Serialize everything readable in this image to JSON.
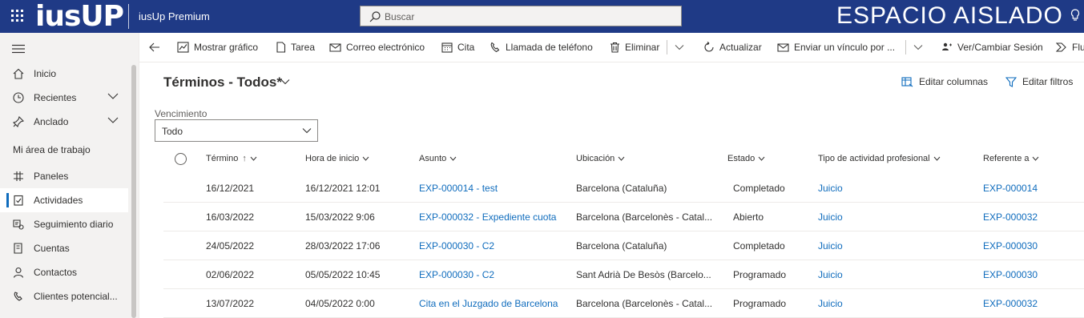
{
  "header": {
    "logo_text": "iusUP",
    "app_name": "iusUp Premium",
    "search_placeholder": "Buscar",
    "environment_label": "ESPACIO AISLADO"
  },
  "command_bar": {
    "back_icon": "arrow-left-icon",
    "items": [
      {
        "label": "Mostrar gráfico",
        "icon": "chart-icon"
      },
      {
        "label": "Tarea",
        "icon": "task-icon"
      },
      {
        "label": "Correo electrónico",
        "icon": "mail-icon"
      },
      {
        "label": "Cita",
        "icon": "calendar-icon"
      },
      {
        "label": "Llamada de teléfono",
        "icon": "phone-icon"
      },
      {
        "label": "Eliminar",
        "icon": "trash-icon"
      },
      {
        "label": "Actualizar",
        "icon": "refresh-icon"
      },
      {
        "label": "Enviar un vínculo por ...",
        "icon": "send-link-icon"
      },
      {
        "label": "Ver/Cambiar Sesión",
        "icon": "session-icon"
      },
      {
        "label": "Flu",
        "icon": "flow-icon"
      }
    ]
  },
  "sidebar": {
    "items": [
      {
        "label": "Inicio",
        "icon": "home-icon"
      },
      {
        "label": "Recientes",
        "icon": "clock-icon"
      },
      {
        "label": "Anclado",
        "icon": "pin-icon"
      }
    ],
    "section_title": "Mi área de trabajo",
    "workspace_items": [
      {
        "label": "Paneles",
        "icon": "dashboard-icon"
      },
      {
        "label": "Actividades",
        "icon": "activities-icon"
      },
      {
        "label": "Seguimiento diario",
        "icon": "tracking-icon"
      },
      {
        "label": "Cuentas",
        "icon": "accounts-icon"
      },
      {
        "label": "Contactos",
        "icon": "contact-icon"
      },
      {
        "label": "Clientes potencial...",
        "icon": "leads-icon"
      }
    ],
    "active": "Actividades"
  },
  "view": {
    "title": "Términos - Todos*",
    "edit_columns_label": "Editar columnas",
    "edit_filters_label": "Editar filtros",
    "filter_label": "Vencimiento",
    "filter_value": "Todo"
  },
  "grid": {
    "columns": [
      {
        "label": "Término",
        "sort_up": true
      },
      {
        "label": "Hora de inicio"
      },
      {
        "label": "Asunto"
      },
      {
        "label": "Ubicación"
      },
      {
        "label": "Estado"
      },
      {
        "label": "Tipo de actividad profesional"
      },
      {
        "label": "Referente a"
      }
    ],
    "rows": [
      [
        "16/12/2021",
        "16/12/2021 12:01",
        "EXP-000014 - test",
        "Barcelona (Cataluña)",
        "Completado",
        "Juicio",
        "EXP-000014"
      ],
      [
        "16/03/2022",
        "15/03/2022 9:06",
        "EXP-000032 - Expediente cuota",
        "Barcelona (Barcelonès - Catal...",
        "Abierto",
        "Juicio",
        "EXP-000032"
      ],
      [
        "24/05/2022",
        "28/03/2022 17:06",
        "EXP-000030 - C2",
        "Barcelona (Cataluña)",
        "Completado",
        "Juicio",
        "EXP-000030"
      ],
      [
        "02/06/2022",
        "05/05/2022 10:45",
        "EXP-000030 - C2",
        "Sant Adrià De Besòs (Barcelo...",
        "Programado",
        "Juicio",
        "EXP-000030"
      ],
      [
        "13/07/2022",
        "04/05/2022 0:00",
        "Cita en el Juzgado de Barcelona",
        "Barcelona (Barcelonès - Catal...",
        "Programado",
        "Juicio",
        "EXP-000032"
      ]
    ]
  },
  "colors": {
    "header_bg": "#1f3a86",
    "link": "#0f6cbd",
    "nav_bg": "#f3f2f1"
  }
}
